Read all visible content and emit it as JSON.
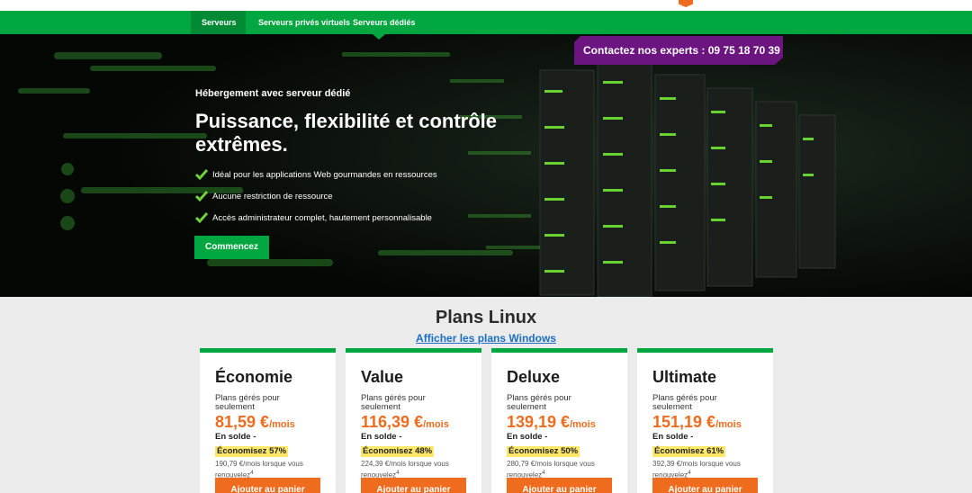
{
  "nav": {
    "tabs": [
      {
        "label": "Serveurs",
        "active": true
      },
      {
        "label": "Serveurs privés virtuels",
        "active": false
      },
      {
        "label": "Serveurs dédiés",
        "active": false
      }
    ]
  },
  "hero": {
    "contact_label": "Contactez nos experts",
    "contact_phone": ": 09 75 18 70 39",
    "eyebrow": "Hébergement avec serveur dédié",
    "headline": "Puissance, flexibilité et contrôle extrêmes.",
    "features": [
      "Idéal pour les applications Web gourmandes en ressources",
      "Aucune restriction de ressource",
      "Accès administrateur complet, hautement personnalisable"
    ],
    "cta_label": "Commencez"
  },
  "plans": {
    "title": "Plans Linux",
    "link": "Afficher les plans Windows",
    "items": [
      {
        "name": "Économie",
        "subtitle": "Plans gérés pour seulement",
        "price": "81,59 €",
        "per": "/mois",
        "sale": "En solde -",
        "badge": "Économisez 57%",
        "renew": "190,79 €/mois lorsque vous renouvelez",
        "sup": "4",
        "cart": "Ajouter au panier"
      },
      {
        "name": "Value",
        "subtitle": "Plans gérés pour seulement",
        "price": "116,39 €",
        "per": "/mois",
        "sale": "En solde -",
        "badge": "Économisez 48%",
        "renew": "224,39 €/mois lorsque vous renouvelez",
        "sup": "4",
        "cart": "Ajouter au panier"
      },
      {
        "name": "Deluxe",
        "subtitle": "Plans gérés pour seulement",
        "price": "139,19 €",
        "per": "/mois",
        "sale": "En solde -",
        "badge": "Économisez 50%",
        "renew": "280,79 €/mois lorsque vous renouvelez",
        "sup": "4",
        "cart": "Ajouter au panier"
      },
      {
        "name": "Ultimate",
        "subtitle": "Plans gérés pour seulement",
        "price": "151,19 €",
        "per": "/mois",
        "sale": "En solde -",
        "badge": "Économisez 61%",
        "renew": "392,39 €/mois lorsque vous renouvelez",
        "sup": "4",
        "cart": "Ajouter au panier"
      }
    ]
  },
  "colors": {
    "brand_green": "#00a63f",
    "accent_orange": "#ef6c1e",
    "contact_purple": "#6c1480",
    "link_blue": "#1c6fc3",
    "badge_yellow": "#fde86a"
  }
}
